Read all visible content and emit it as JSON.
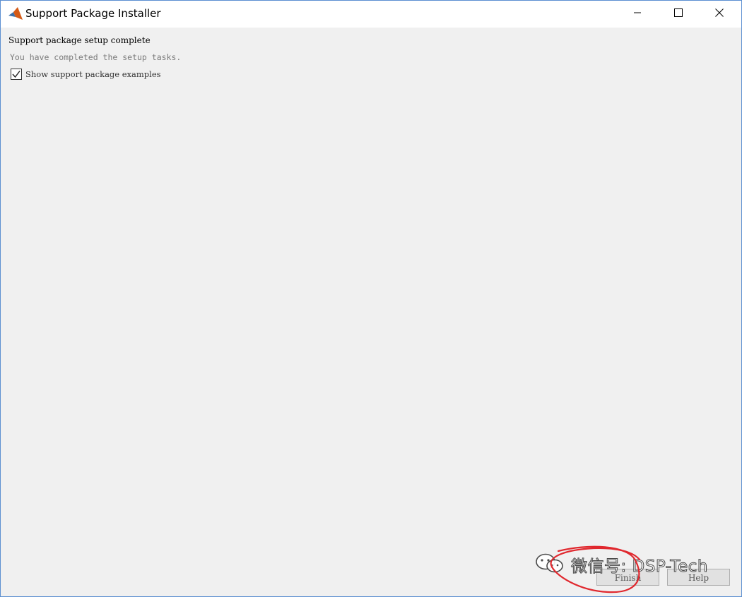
{
  "window": {
    "title": "Support Package Installer",
    "app_icon": "matlab-logo-icon",
    "controls": [
      "minimize-icon",
      "maximize-icon",
      "close-icon"
    ]
  },
  "content": {
    "heading": "Support package setup complete",
    "subtext": "You have completed the setup tasks.",
    "checkbox": {
      "label": "Show support package examples",
      "checked": true
    }
  },
  "buttons": {
    "finish_label": "Finish",
    "help_label": "Help"
  },
  "watermark": {
    "text": "微信号: DSP-Tech",
    "icon": "wechat-icon"
  },
  "annotation": {
    "color": "#e0282e",
    "shape": "hand-drawn circle around Finish button"
  }
}
